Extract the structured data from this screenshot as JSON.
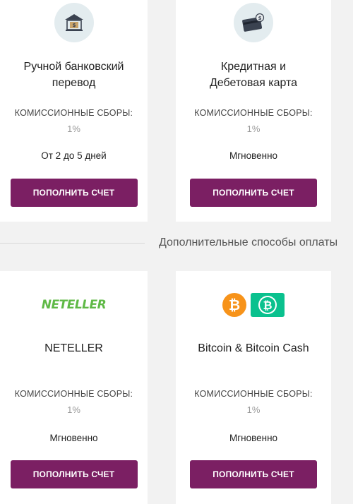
{
  "common": {
    "fee_label": "КОМИССИОННЫЕ СБОРЫ:",
    "button_label": "ПОПОЛНИТЬ СЧЕТ"
  },
  "divider": {
    "label": "Дополнительные способы оплаты"
  },
  "methods": [
    {
      "icon": "bank-icon",
      "title": "Ручной банковский\nперевод",
      "fee": "1%",
      "time": "От 2 до 5 дней"
    },
    {
      "icon": "credit-card-icon",
      "title": "Кредитная и\nДебетовая карта",
      "fee": "1%",
      "time": "Мгновенно"
    },
    {
      "logo_text": "NETELLER",
      "title": "NETELLER",
      "fee": "1%",
      "time": "Мгновенно"
    },
    {
      "icon": "bitcoin-icon",
      "title": "Bitcoin & Bitcoin Cash",
      "fee": "1%",
      "time": "Мгновенно"
    }
  ],
  "colors": {
    "button": "#7b1f63",
    "neteller": "#5fb946",
    "bitcoin": "#f7931a",
    "bitcoin_cash": "#0ac18e",
    "icon_circle": "#e3ecef"
  }
}
